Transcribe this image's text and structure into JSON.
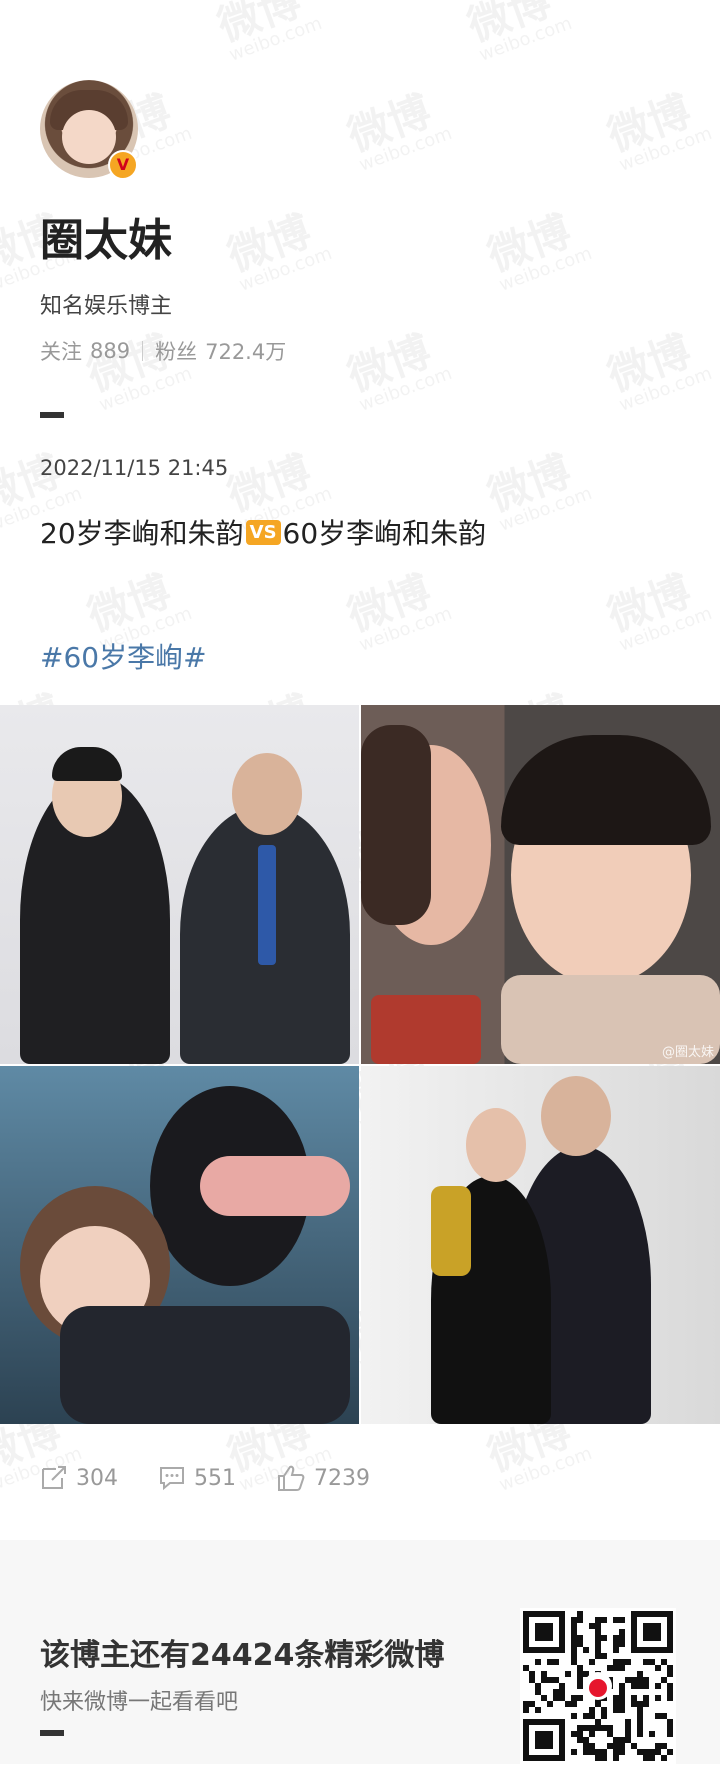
{
  "profile": {
    "name": "圈太妹",
    "subtitle": "知名娱乐博主",
    "following_label": "关注",
    "following_count": "889",
    "followers_label": "粉丝",
    "followers_count": "722.4万"
  },
  "post": {
    "date": "2022/11/15 21:45",
    "text_before": "20岁李峋和朱韵",
    "vs_badge": "VS",
    "text_after": "60岁李峋和朱韵",
    "hashtag": "#60岁李峋#",
    "image_watermark": "@圈太妹"
  },
  "actions": {
    "repost_count": "304",
    "comment_count": "551",
    "like_count": "7239"
  },
  "footer": {
    "title": "该博主还有24424条精彩微博",
    "subtitle": "快来微博一起看看吧"
  },
  "watermark": {
    "main": "微博",
    "sub": "weibo.com"
  },
  "colors": {
    "hashtag": "#4a78a8",
    "vs_badge": "#f5a623",
    "verified": "#f5a623"
  }
}
